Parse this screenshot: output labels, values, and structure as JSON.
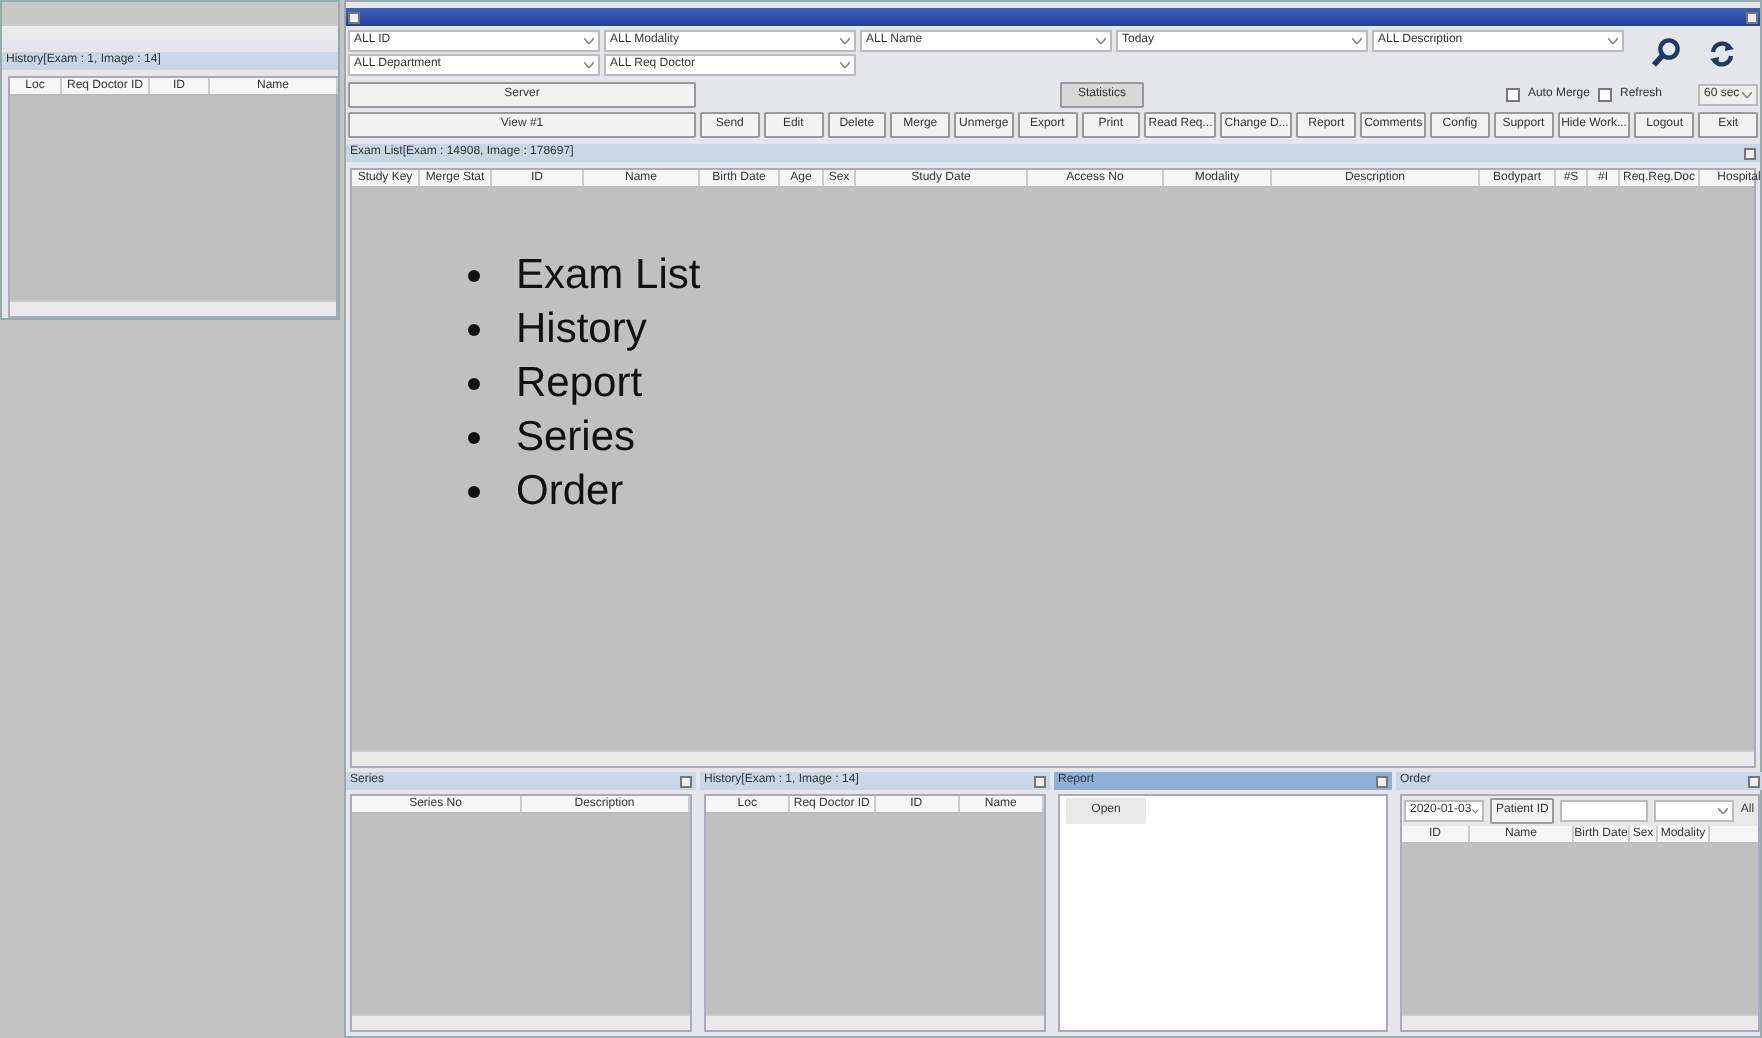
{
  "left_window": {
    "title": "History[Exam : 1, Image : 14]",
    "columns": [
      "Loc",
      "Req Doctor ID",
      "ID",
      "Name"
    ]
  },
  "main_window": {
    "filters": [
      {
        "value": "ALL ID"
      },
      {
        "value": "ALL Modality"
      },
      {
        "value": "ALL Name"
      },
      {
        "value": "Today"
      },
      {
        "value": "ALL Description"
      },
      {
        "value": "ALL Department"
      },
      {
        "value": "ALL Req Doctor"
      }
    ],
    "server_button": "Server",
    "statistics_button": "Statistics",
    "checkboxes": [
      {
        "label": "Auto Merge",
        "checked": false
      },
      {
        "label": "Refresh",
        "checked": false
      }
    ],
    "interval": "60 sec",
    "view_button": "View #1",
    "buttons": [
      "Send",
      "Edit",
      "Delete",
      "Merge",
      "Unmerge",
      "Export",
      "Print",
      "Read Req...",
      "Change D...",
      "Report",
      "Comments",
      "Config",
      "Support",
      "Hide Work...",
      "Logout",
      "Exit"
    ],
    "exam_list": {
      "title": "Exam List[Exam : 14908, Image : 178697]",
      "columns": [
        "Study Key",
        "Merge Stat",
        "ID",
        "Name",
        "Birth Date",
        "Age",
        "Sex",
        "Study Date",
        "Access No",
        "Modality",
        "Description",
        "Bodypart",
        "#S",
        "#I",
        "Req.Reg.Doc",
        "Hospital"
      ]
    },
    "overlay_list": [
      "Exam List",
      "History",
      "Report",
      "Series",
      "Order"
    ],
    "panels": [
      {
        "kind": "table",
        "title": "Series",
        "active": false,
        "columns": [
          "Series No",
          "Description"
        ]
      },
      {
        "kind": "table",
        "title": "History[Exam : 1, Image : 14]",
        "active": false,
        "columns": [
          "Loc",
          "Req Doctor ID",
          "ID",
          "Name"
        ]
      },
      {
        "kind": "report",
        "title": "Report",
        "active": true,
        "button": "Open"
      },
      {
        "kind": "order",
        "title": "Order",
        "active": false,
        "date": "2020-01-03",
        "patient_button": "Patient ID",
        "filter": "All",
        "columns": [
          "ID",
          "Name",
          "Birth Date",
          "Sex",
          "Modality"
        ]
      }
    ]
  }
}
